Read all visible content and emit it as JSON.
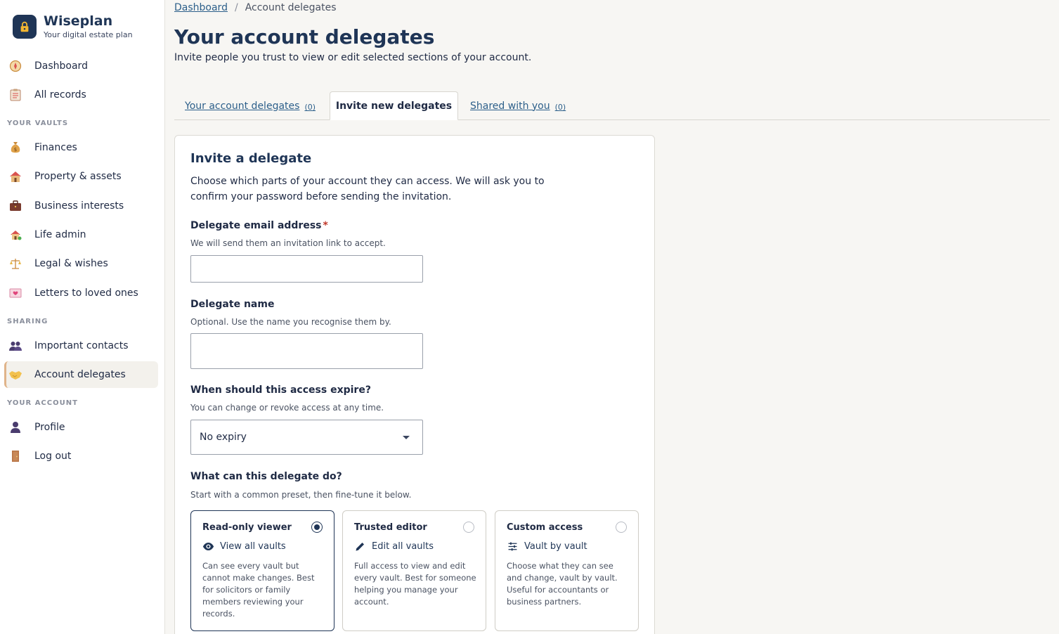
{
  "brand": {
    "name": "Wiseplan",
    "tagline": "Your digital estate plan"
  },
  "sidebar": {
    "top_items": [
      {
        "label": "Dashboard",
        "icon": "compass-icon"
      },
      {
        "label": "All records",
        "icon": "clipboard-icon"
      }
    ],
    "sections": [
      {
        "label": "YOUR VAULTS"
      },
      {
        "label": "SHARING"
      },
      {
        "label": "YOUR ACCOUNT"
      }
    ],
    "vault_items": [
      {
        "label": "Finances",
        "icon": "money-bag-icon"
      },
      {
        "label": "Property & assets",
        "icon": "house-icon"
      },
      {
        "label": "Business interests",
        "icon": "briefcase-icon"
      },
      {
        "label": "Life admin",
        "icon": "home-garden-icon"
      },
      {
        "label": "Legal & wishes",
        "icon": "scales-icon"
      },
      {
        "label": "Letters to loved ones",
        "icon": "love-letter-icon"
      }
    ],
    "sharing_items": [
      {
        "label": "Important contacts",
        "icon": "people-icon"
      },
      {
        "label": "Account delegates",
        "icon": "handshake-icon",
        "active": true
      }
    ],
    "account_items": [
      {
        "label": "Profile",
        "icon": "person-icon"
      },
      {
        "label": "Log out",
        "icon": "door-icon"
      }
    ]
  },
  "breadcrumb": {
    "home": "Dashboard",
    "separator": "/",
    "current": "Account delegates"
  },
  "page": {
    "title": "Your account delegates",
    "subtitle": "Invite people you trust to view or edit selected sections of your account."
  },
  "tabs": [
    {
      "label": "Your account delegates",
      "count": "(0)"
    },
    {
      "label": "Invite new delegates",
      "active": true
    },
    {
      "label": "Shared with you",
      "count": "(0)"
    }
  ],
  "form": {
    "title": "Invite a delegate",
    "description": "Choose which parts of your account they can access. We will ask you to confirm your password before sending the invitation.",
    "email": {
      "label": "Delegate email address",
      "required_mark": "*",
      "hint": "We will send them an invitation link to accept.",
      "value": ""
    },
    "name": {
      "label": "Delegate name",
      "hint": "Optional. Use the name you recognise them by.",
      "value": ""
    },
    "expiry": {
      "label": "When should this access expire?",
      "hint": "You can change or revoke access at any time.",
      "selected": "No expiry"
    },
    "permissions": {
      "label": "What can this delegate do?",
      "hint": "Start with a common preset, then fine-tune it below.",
      "presets": [
        {
          "title": "Read-only viewer",
          "scope": "View all vaults",
          "scope_icon": "eye-icon",
          "description": "Can see every vault but cannot make changes. Best for solicitors or family members reviewing your records.",
          "selected": true
        },
        {
          "title": "Trusted editor",
          "scope": "Edit all vaults",
          "scope_icon": "pencil-icon",
          "description": "Full access to view and edit every vault. Best for someone helping you manage your account.",
          "selected": false
        },
        {
          "title": "Custom access",
          "scope": "Vault by vault",
          "scope_icon": "sliders-icon",
          "description": "Choose what they can see and change, vault by vault. Useful for accountants or business partners.",
          "selected": false
        }
      ]
    }
  },
  "colors": {
    "navy": "#1f3556",
    "link": "#2c5f8a",
    "background": "#f7f6f3",
    "active_accent": "#e0b48a"
  }
}
